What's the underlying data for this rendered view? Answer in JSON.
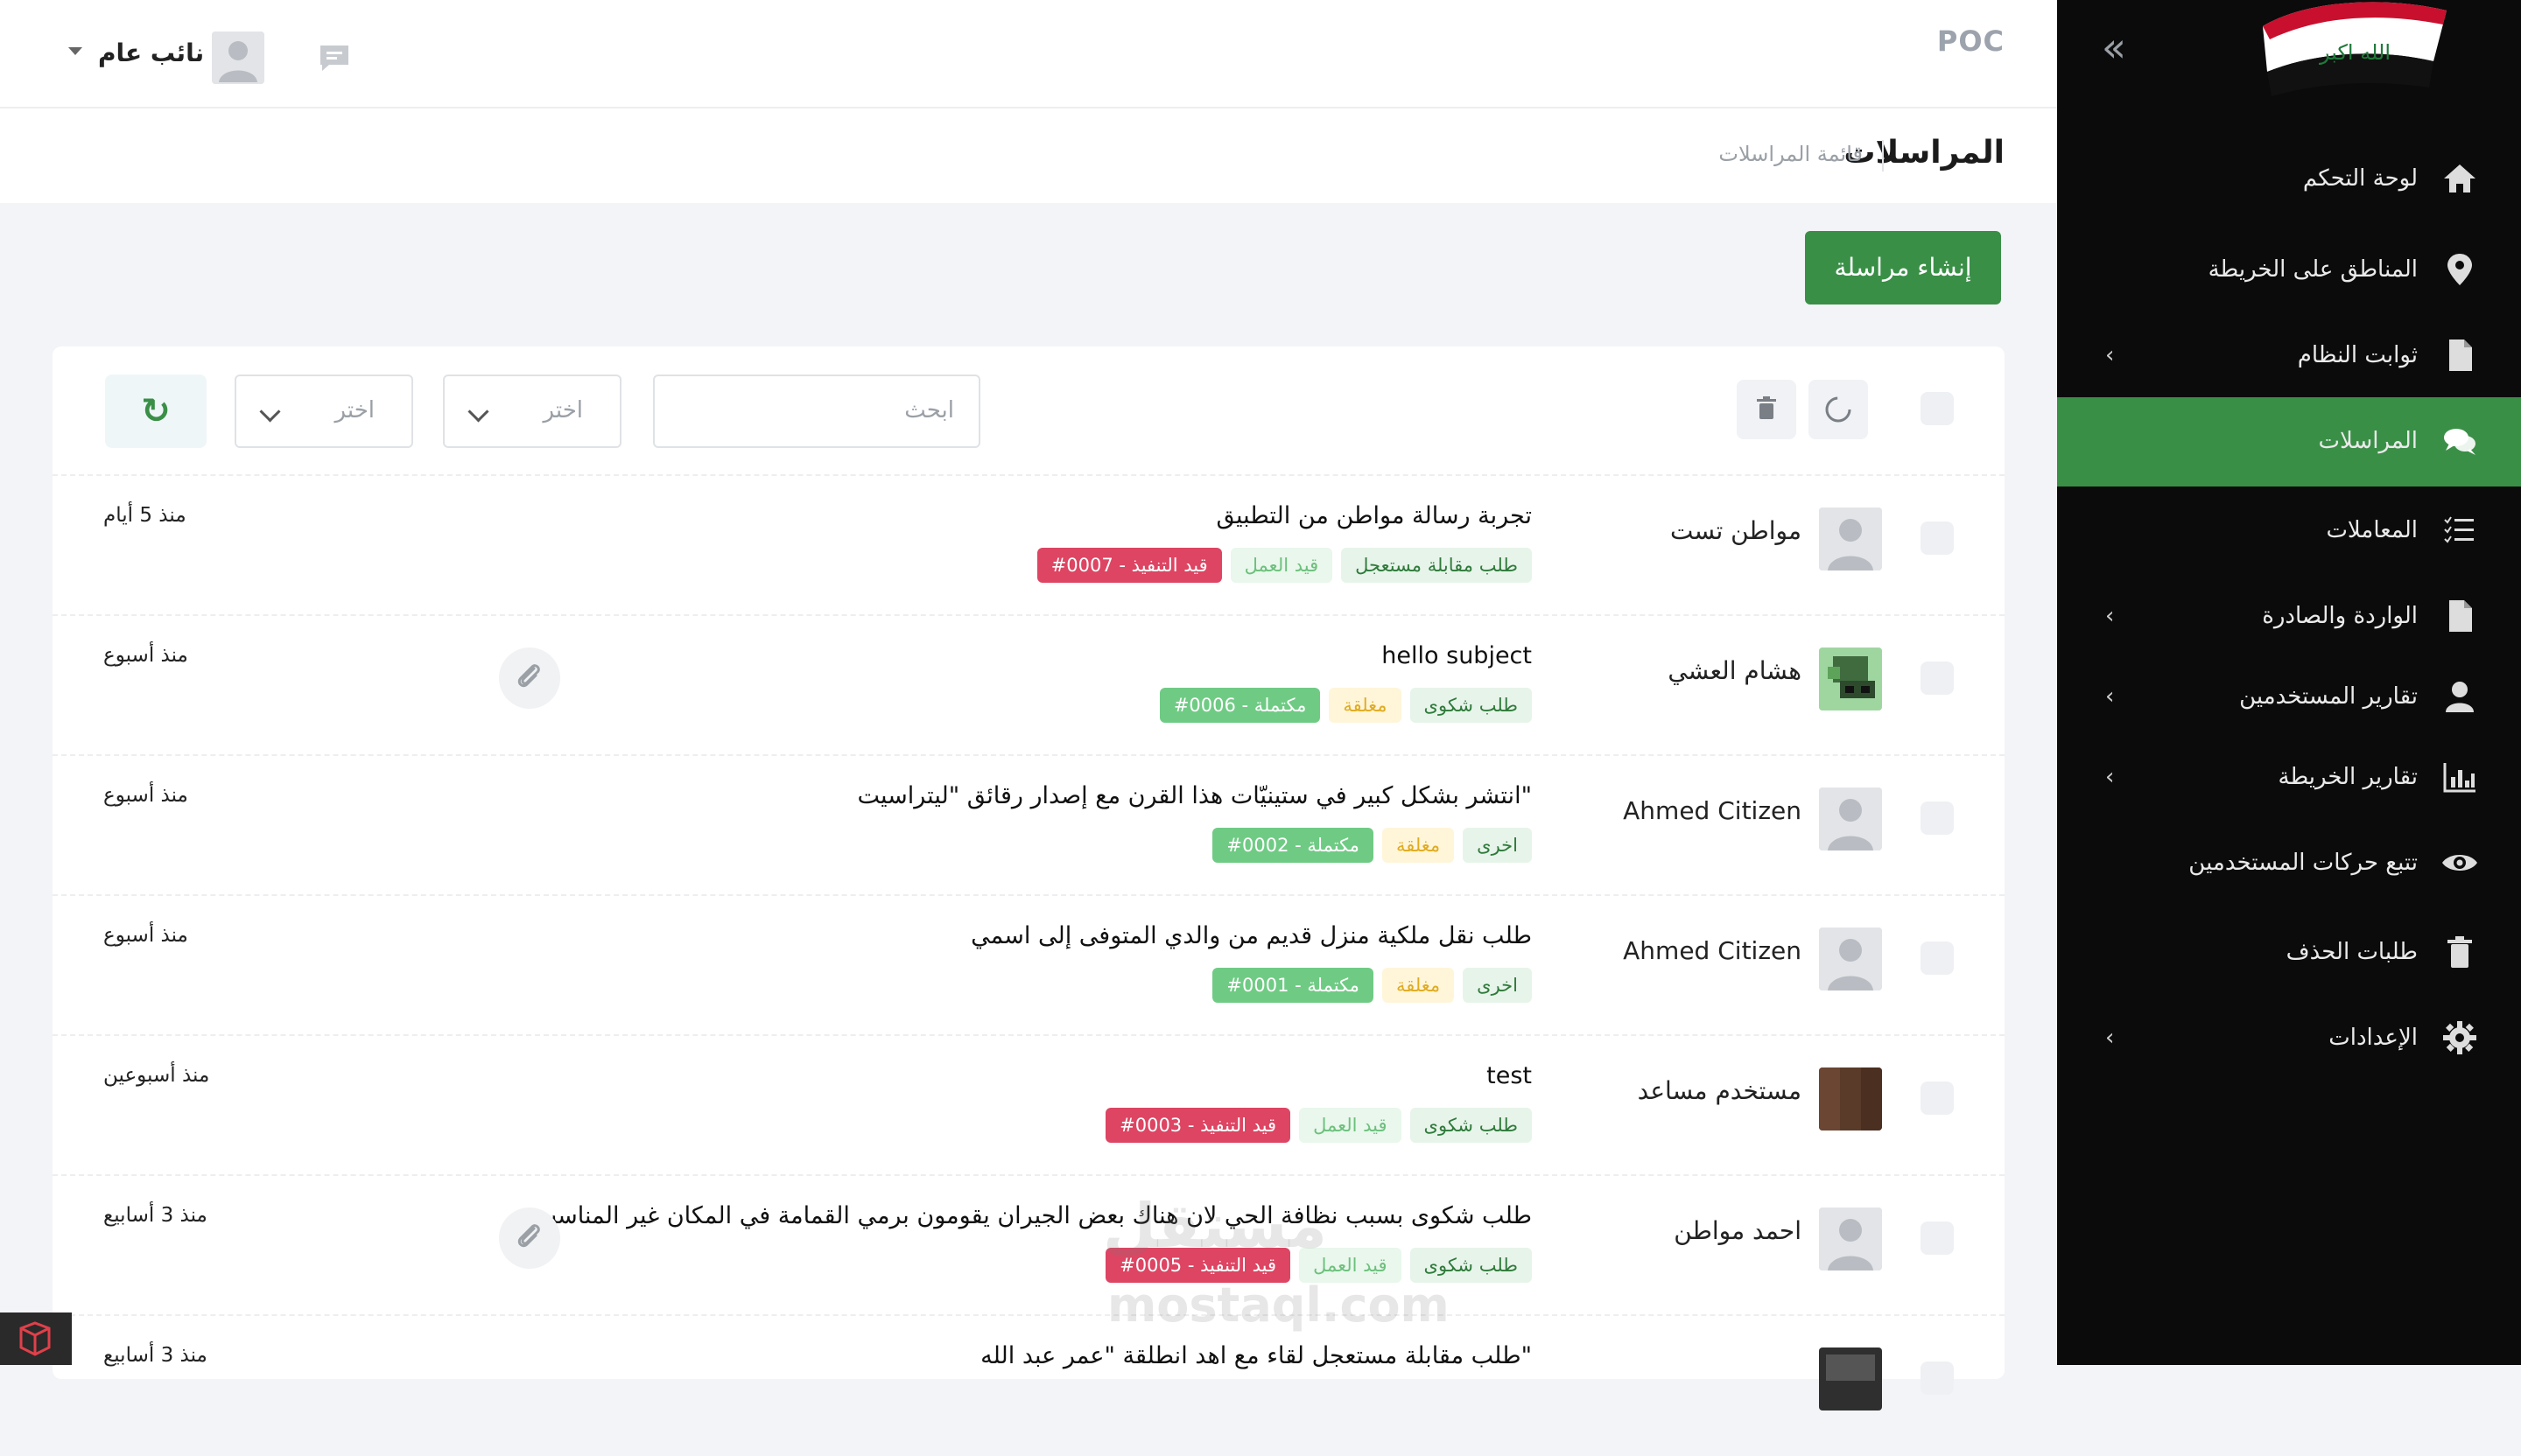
{
  "topbar": {
    "app_title": "POC",
    "user_name": "نائب عام"
  },
  "titlebar": {
    "title": "المراسلات",
    "breadcrumb": "قائمة المراسلات"
  },
  "actions": {
    "create_label": "إنشاء مراسلة"
  },
  "filters": {
    "search_placeholder": "ابحث",
    "select1_text": "اختر",
    "select2_text": "اختر",
    "refresh_icon": "↻"
  },
  "sidebar": {
    "items": [
      {
        "label": "لوحة التحكم",
        "icon": "home-icon",
        "chevron": false,
        "active": false
      },
      {
        "label": "المناطق على الخريطة",
        "icon": "map-pin-icon",
        "chevron": false,
        "active": false
      },
      {
        "label": "ثوابت النظام",
        "icon": "file-icon",
        "chevron": true,
        "active": false
      },
      {
        "label": "المراسلات",
        "icon": "comments-icon",
        "chevron": false,
        "active": true
      },
      {
        "label": "المعاملات",
        "icon": "tasks-icon",
        "chevron": false,
        "active": false
      },
      {
        "label": "الواردة والصادرة",
        "icon": "file-icon",
        "chevron": true,
        "active": false
      },
      {
        "label": "تقارير المستخدمين",
        "icon": "user-icon",
        "chevron": true,
        "active": false
      },
      {
        "label": "تقارير الخريطة",
        "icon": "chart-icon",
        "chevron": true,
        "active": false
      },
      {
        "label": "تتبع حركات المستخدمين",
        "icon": "eye-icon",
        "chevron": false,
        "active": false
      },
      {
        "label": "طلبات الحذف",
        "icon": "trash-icon",
        "chevron": false,
        "active": false
      },
      {
        "label": "الإعدادات",
        "icon": "gear-icon",
        "chevron": true,
        "active": false
      }
    ],
    "chevron_glyph": "‹",
    "collapse_glyph": "«"
  },
  "rows": [
    {
      "sender": "مواطن تست",
      "subject": "تجربة رسالة مواطن من التطبيق",
      "tags": [
        {
          "text": "طلب مقابلة مستعجل",
          "kind": "type"
        },
        {
          "text": "قيد العمل",
          "kind": "in-progress-light"
        },
        {
          "text": "#0007 - قيد التنفيذ",
          "kind": "ref-red"
        }
      ],
      "time": "منذ 5 أيام",
      "attachment": false,
      "avatar": "default"
    },
    {
      "sender": "هشام العشي",
      "subject": "hello subject",
      "tags": [
        {
          "text": "طلب شكوى",
          "kind": "type"
        },
        {
          "text": "مغلقة",
          "kind": "closed"
        },
        {
          "text": "#0006 - مكتملة",
          "kind": "ref-green"
        }
      ],
      "time": "منذ أسبوع",
      "attachment": true,
      "avatar": "pixel"
    },
    {
      "sender": "Ahmed Citizen",
      "subject": "انتشر بشكل كبير في ستينيّات هذا القرن مع إصدار رقائق \"ليتراسيت\"",
      "tags": [
        {
          "text": "اخرى",
          "kind": "type"
        },
        {
          "text": "مغلقة",
          "kind": "closed"
        },
        {
          "text": "#0002 - مكتملة",
          "kind": "ref-green"
        }
      ],
      "time": "منذ أسبوع",
      "attachment": false,
      "avatar": "default"
    },
    {
      "sender": "Ahmed Citizen",
      "subject": "طلب نقل ملكية منزل قديم من والدي المتوفى إلى اسمي",
      "tags": [
        {
          "text": "اخرى",
          "kind": "type"
        },
        {
          "text": "مغلقة",
          "kind": "closed"
        },
        {
          "text": "#0001 - مكتملة",
          "kind": "ref-green"
        }
      ],
      "time": "منذ أسبوع",
      "attachment": false,
      "avatar": "default"
    },
    {
      "sender": "مستخدم مساعد",
      "subject": "test",
      "tags": [
        {
          "text": "طلب شكوى",
          "kind": "type"
        },
        {
          "text": "قيد العمل",
          "kind": "in-progress-light"
        },
        {
          "text": "#0003 - قيد التنفيذ",
          "kind": "ref-red"
        }
      ],
      "time": "منذ أسبوعين",
      "attachment": false,
      "avatar": "wood"
    },
    {
      "sender": "احمد مواطن",
      "subject": "طلب شكوى بسبب نظافة الحي لان هناك بعض الجيران يقومون برمي القمامة في المكان غير المناسب",
      "tags": [
        {
          "text": "طلب شكوى",
          "kind": "type"
        },
        {
          "text": "قيد العمل",
          "kind": "in-progress-light"
        },
        {
          "text": "#0005 - قيد التنفيذ",
          "kind": "ref-red"
        }
      ],
      "time": "منذ 3 أسابيع",
      "attachment": true,
      "avatar": "default"
    },
    {
      "sender": "",
      "subject": "طلب مقابلة مستعجل لقاء مع اهد انطلقة \"عمر عبد الله\"",
      "tags": [],
      "time": "منذ 3 أسابيع",
      "attachment": false,
      "avatar": "dark"
    }
  ],
  "watermark": {
    "arabic": "مستقل",
    "latin": "mostaql.com"
  },
  "colors": {
    "accent": "#3a8f47",
    "sidebar_bg": "#0b0b0b",
    "danger": "#dd4563",
    "success": "#6fcb84",
    "warning_bg": "#fff5d9"
  }
}
